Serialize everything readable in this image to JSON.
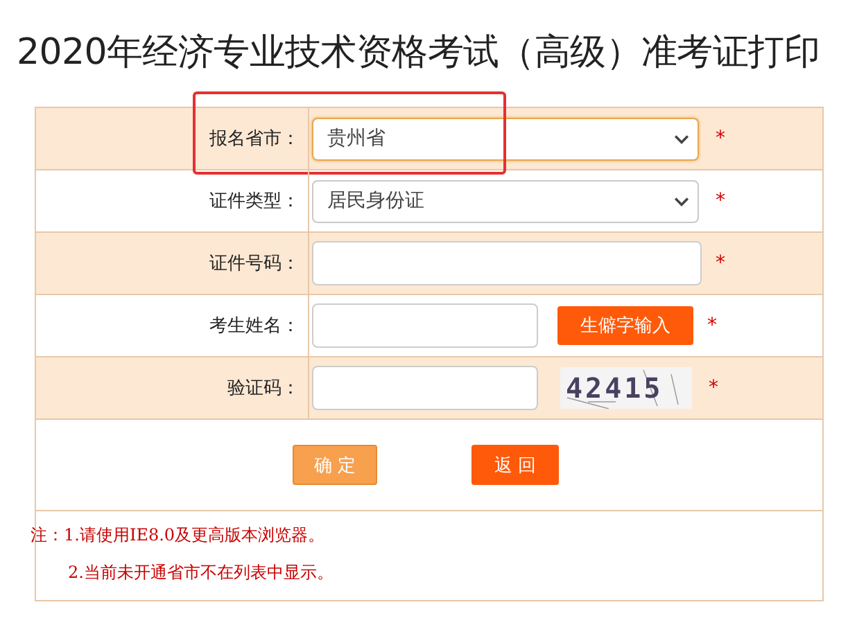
{
  "title": "2020年经济专业技术资格考试（高级）准考证打印",
  "rows": [
    {
      "kind": "select",
      "label": "报名省市：",
      "value": "贵州省",
      "focused": true,
      "highlighted": true,
      "required": "*"
    },
    {
      "kind": "select",
      "label": "证件类型：",
      "value": "居民身份证",
      "focused": false,
      "highlighted": false,
      "required": "*"
    },
    {
      "kind": "text",
      "label": "证件号码：",
      "highlighted": false,
      "required": "*"
    },
    {
      "kind": "text-button",
      "label": "考生姓名：",
      "button": "生僻字输入",
      "highlighted": false,
      "required": "*"
    },
    {
      "kind": "captcha",
      "label": "验证码：",
      "captcha": "42415",
      "highlighted": false,
      "required": "*"
    }
  ],
  "buttons": [
    {
      "label": "确 定",
      "kind": "confirm"
    },
    {
      "label": "返 回",
      "kind": "back"
    }
  ],
  "notes": [
    "注：1.请使用IE8.0及更高版本浏览器。",
    "2.当前未开通省市不在列表中显示。"
  ]
}
